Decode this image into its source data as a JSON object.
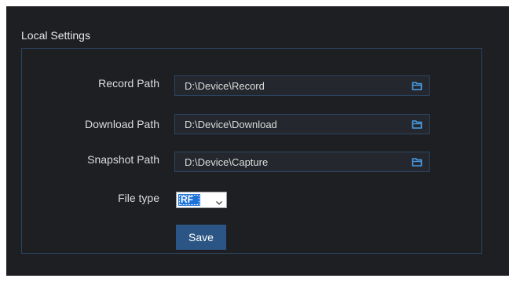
{
  "section": {
    "title": "Local Settings"
  },
  "rows": [
    {
      "label": "Record Path",
      "value": "D:\\Device\\Record",
      "icon": "folder-icon"
    },
    {
      "label": "Download Path",
      "value": "D:\\Device\\Download",
      "icon": "folder-icon"
    },
    {
      "label": "Snapshot Path",
      "value": "D:\\Device\\Capture",
      "icon": "folder-icon"
    }
  ],
  "file_type": {
    "label": "File type",
    "selected": "RF"
  },
  "actions": {
    "save_label": "Save"
  },
  "colors": {
    "background": "#1e1f23",
    "border": "#2c4664",
    "accent": "#2b5585",
    "selected": "#1e73d8",
    "icon": "#4a9ee8"
  }
}
